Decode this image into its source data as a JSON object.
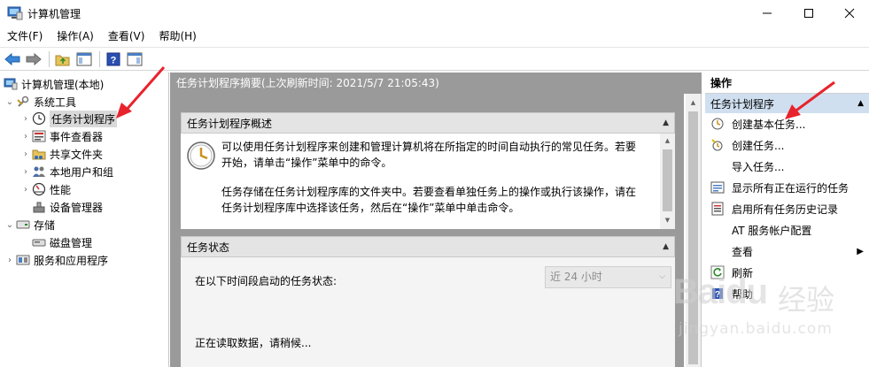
{
  "window": {
    "title": "计算机管理"
  },
  "menu": [
    "文件(F)",
    "操作(A)",
    "查看(V)",
    "帮助(H)"
  ],
  "tree": {
    "root": "计算机管理(本地)",
    "system_tools": "系统工具",
    "task_scheduler": "任务计划程序",
    "event_viewer": "事件查看器",
    "shared_folders": "共享文件夹",
    "local_users": "本地用户和组",
    "performance": "性能",
    "device_manager": "设备管理器",
    "storage": "存储",
    "disk_management": "磁盘管理",
    "services_apps": "服务和应用程序"
  },
  "center": {
    "header": "任务计划程序摘要(上次刷新时间: 2021/5/7 21:05:43)",
    "overview_title": "任务计划程序概述",
    "overview_p1": "可以使用任务计划程序来创建和管理计算机将在所指定的时间自动执行的常见任务。若要开始，请单击“操作”菜单中的命令。",
    "overview_p2": "任务存储在任务计划程序库的文件夹中。若要查看单独任务上的操作或执行该操作，请在任务计划程序库中选择该任务，然后在“操作”菜单中单击命令。",
    "status_title": "任务状态",
    "status_label": "在以下时间段启动的任务状态:",
    "status_select": "近 24 小时",
    "loading_text": "正在读取数据，请稍候..."
  },
  "actions": {
    "header": "操作",
    "section": "任务计划程序",
    "items": [
      "创建基本任务...",
      "创建任务...",
      "导入任务...",
      "显示所有正在运行的任务",
      "启用所有任务历史记录",
      "AT 服务帐户配置",
      "查看",
      "刷新",
      "帮助"
    ]
  },
  "watermark": {
    "brand": "Baidu",
    "brand_cn": "经验",
    "url": "jingyan.baidu.com"
  },
  "colors": {
    "accent_section": "#cfdff0",
    "center_bg": "#9a9a9a",
    "arrow": "#e8232c"
  }
}
